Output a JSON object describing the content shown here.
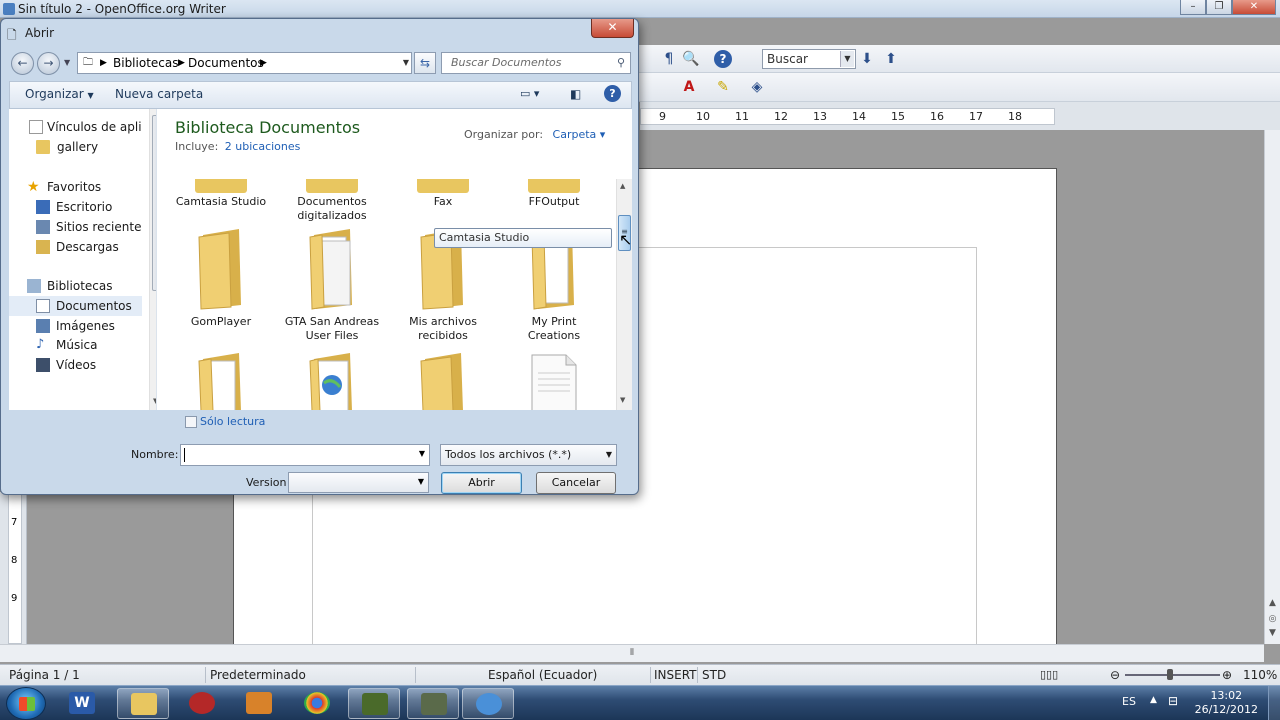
{
  "window": {
    "title": "Sin título 2 - OpenOffice.org Writer",
    "controls": {
      "minimize": "–",
      "maximize": "❐",
      "close": "✕"
    }
  },
  "toolbar": {
    "find_placeholder": "Buscar"
  },
  "ruler": {
    "ticks": [
      "9",
      "10",
      "11",
      "12",
      "13",
      "14",
      "15",
      "16",
      "17",
      "18"
    ]
  },
  "vruler": {
    "ticks": [
      "7",
      "8",
      "9"
    ]
  },
  "statusbar": {
    "page": "Página 1 / 1",
    "style": "Predeterminado",
    "language": "Español (Ecuador)",
    "insert_mode": "INSERT",
    "selection_mode": "STD",
    "zoom": "110%"
  },
  "taskbar": {
    "language": "ES",
    "time": "13:02",
    "date": "26/12/2012"
  },
  "dialog": {
    "title": "Abrir",
    "address": {
      "crumbs": [
        "Bibliotecas",
        "Documentos"
      ]
    },
    "search_placeholder": "Buscar Documentos",
    "commands": {
      "organize": "Organizar",
      "new_folder": "Nueva carpeta"
    },
    "nav": [
      {
        "label": "Vínculos de aplicac",
        "icon": "page-icon",
        "indent": 1,
        "selected": false
      },
      {
        "label": "gallery",
        "icon": "folder-icon",
        "indent": 1,
        "selected": false
      },
      {
        "label": "Favoritos",
        "icon": "star-icon",
        "indent": 0,
        "selected": false
      },
      {
        "label": "Escritorio",
        "icon": "desktop-icon",
        "indent": 1,
        "selected": false
      },
      {
        "label": "Sitios recientes",
        "icon": "recent-places-icon",
        "indent": 1,
        "selected": false
      },
      {
        "label": "Descargas",
        "icon": "downloads-icon",
        "indent": 1,
        "selected": false
      },
      {
        "label": "Bibliotecas",
        "icon": "libraries-icon",
        "indent": 0,
        "selected": false
      },
      {
        "label": "Documentos",
        "icon": "documents-icon",
        "indent": 1,
        "selected": true
      },
      {
        "label": "Imágenes",
        "icon": "pictures-icon",
        "indent": 1,
        "selected": false
      },
      {
        "label": "Música",
        "icon": "music-icon",
        "indent": 1,
        "selected": false
      },
      {
        "label": "Vídeos",
        "icon": "videos-icon",
        "indent": 1,
        "selected": false
      }
    ],
    "library": {
      "title": "Biblioteca Documentos",
      "includes_label": "Incluye:",
      "includes_link": "2 ubicaciones",
      "arrange_label": "Organizar por:",
      "arrange_value": "Carpeta"
    },
    "items_row0": [
      {
        "label": "Camtasia Studio"
      },
      {
        "label": "Documentos digitalizados"
      },
      {
        "label": "Fax"
      },
      {
        "label": "FFOutput"
      }
    ],
    "items_row1": [
      {
        "label": "GomPlayer",
        "kind": "folder"
      },
      {
        "label": "GTA San Andreas User Files",
        "kind": "folder-docs"
      },
      {
        "label": "Mis archivos recibidos",
        "kind": "folder"
      },
      {
        "label": "My Print Creations",
        "kind": "folder-docs"
      }
    ],
    "items_row2": [
      {
        "kind": "folder-docs"
      },
      {
        "kind": "folder-web"
      },
      {
        "kind": "folder"
      },
      {
        "kind": "file"
      }
    ],
    "tooltip": "Camtasia Studio",
    "readonly_label": "Sólo lectura",
    "name_label": "Nombre:",
    "name_value": "",
    "filter_value": "Todos los archivos (*.*)",
    "version_label": "Version",
    "version_value": "",
    "open_button": "Abrir",
    "cancel_button": "Cancelar"
  }
}
